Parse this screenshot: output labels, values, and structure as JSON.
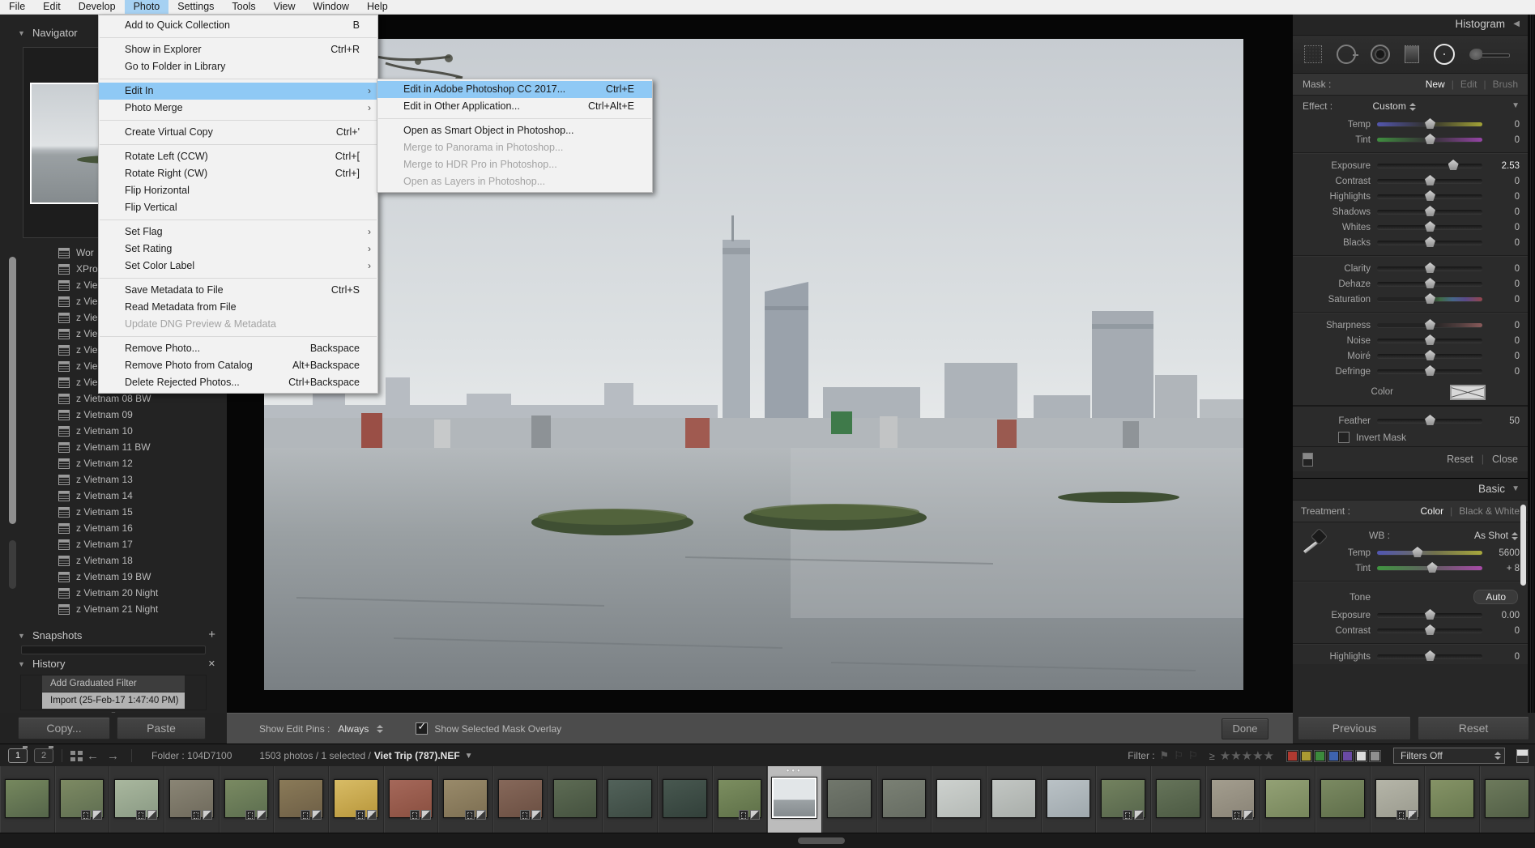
{
  "menu_bar": {
    "items": [
      "File",
      "Edit",
      "Develop",
      "Photo",
      "Settings",
      "Tools",
      "View",
      "Window",
      "Help"
    ],
    "selected": "Photo"
  },
  "photo_menu": {
    "items": [
      {
        "label": "Add to Quick Collection",
        "shortcut": "B",
        "sep": true
      },
      {
        "label": "Show in Explorer",
        "shortcut": "Ctrl+R"
      },
      {
        "label": "Go to Folder in Library",
        "sep": true
      },
      {
        "label": "Edit In",
        "arrow": true,
        "highlighted": true
      },
      {
        "label": "Photo Merge",
        "arrow": true,
        "sep": true
      },
      {
        "label": "Create Virtual Copy",
        "shortcut": "Ctrl+'",
        "sep": true
      },
      {
        "label": "Rotate Left (CCW)",
        "shortcut": "Ctrl+["
      },
      {
        "label": "Rotate Right (CW)",
        "shortcut": "Ctrl+]"
      },
      {
        "label": "Flip Horizontal"
      },
      {
        "label": "Flip Vertical",
        "sep": true
      },
      {
        "label": "Set Flag",
        "arrow": true
      },
      {
        "label": "Set Rating",
        "arrow": true
      },
      {
        "label": "Set Color Label",
        "arrow": true,
        "sep": true
      },
      {
        "label": "Save Metadata to File",
        "shortcut": "Ctrl+S"
      },
      {
        "label": "Read Metadata from File"
      },
      {
        "label": "Update DNG Preview & Metadata",
        "disabled": true,
        "sep": true
      },
      {
        "label": "Remove Photo...",
        "shortcut": "Backspace"
      },
      {
        "label": "Remove Photo from Catalog",
        "shortcut": "Alt+Backspace"
      },
      {
        "label": "Delete Rejected Photos...",
        "shortcut": "Ctrl+Backspace"
      }
    ]
  },
  "edit_in_submenu": {
    "items": [
      {
        "label": "Edit in Adobe Photoshop CC 2017...",
        "shortcut": "Ctrl+E",
        "highlighted": true
      },
      {
        "label": "Edit in Other Application...",
        "shortcut": "Ctrl+Alt+E",
        "sep": true
      },
      {
        "label": "Open as Smart Object in Photoshop..."
      },
      {
        "label": "Merge to Panorama in Photoshop...",
        "disabled": true
      },
      {
        "label": "Merge to HDR Pro in Photoshop...",
        "disabled": true
      },
      {
        "label": "Open as Layers in Photoshop...",
        "disabled": true
      }
    ]
  },
  "left_panel": {
    "navigator_title": "Navigator",
    "folders": [
      "Wor",
      "XPro",
      "z Vie",
      "z Vie",
      "z Vie",
      "z Vie",
      "z Vie",
      "z Vie",
      "z Vie",
      "z Vietnam 08 BW",
      "z Vietnam 09",
      "z Vietnam 10",
      "z Vietnam 11 BW",
      "z Vietnam 12",
      "z Vietnam 13",
      "z Vietnam 14",
      "z Vietnam 15",
      "z Vietnam 16",
      "z Vietnam 17",
      "z Vietnam 18",
      "z Vietnam 19 BW",
      "z Vietnam 20 Night",
      "z Vietnam 21 Night"
    ],
    "snapshots_title": "Snapshots",
    "history_title": "History",
    "history_items": [
      {
        "label": "Add Graduated Filter",
        "selected": false
      },
      {
        "label": "Import (25-Feb-17 1:47:40 PM)",
        "selected": true
      }
    ],
    "copy_label": "Copy...",
    "paste_label": "Paste"
  },
  "right_panel": {
    "histogram_title": "Histogram",
    "mask_label": "Mask :",
    "mask_new": "New",
    "mask_edit": "Edit",
    "mask_brush": "Brush",
    "effect_label": "Effect :",
    "effect_value": "Custom",
    "effect_groups": [
      [
        {
          "label": "Temp",
          "value": "0",
          "knob": 50,
          "track": "temp"
        },
        {
          "label": "Tint",
          "value": "0",
          "knob": 50,
          "track": "tint"
        }
      ],
      [
        {
          "label": "Exposure",
          "value": "2.53",
          "knob": 72,
          "bright": true
        },
        {
          "label": "Contrast",
          "value": "0",
          "knob": 50
        },
        {
          "label": "Highlights",
          "value": "0",
          "knob": 50
        },
        {
          "label": "Shadows",
          "value": "0",
          "knob": 50
        },
        {
          "label": "Whites",
          "value": "0",
          "knob": 50
        },
        {
          "label": "Blacks",
          "value": "0",
          "knob": 50
        }
      ],
      [
        {
          "label": "Clarity",
          "value": "0",
          "knob": 50
        },
        {
          "label": "Dehaze",
          "value": "0",
          "knob": 50
        },
        {
          "label": "Saturation",
          "value": "0",
          "knob": 50,
          "track": "sat"
        }
      ],
      [
        {
          "label": "Sharpness",
          "value": "0",
          "knob": 50,
          "track": "sharp"
        },
        {
          "label": "Noise",
          "value": "0",
          "knob": 50
        },
        {
          "label": "Moiré",
          "value": "0",
          "knob": 50
        },
        {
          "label": "Defringe",
          "value": "0",
          "knob": 50
        }
      ]
    ],
    "color_label": "Color",
    "feather": {
      "label": "Feather",
      "value": "50",
      "knob": 50
    },
    "invert_mask_label": "Invert Mask",
    "reset_label": "Reset",
    "close_label": "Close",
    "basic": {
      "title": "Basic",
      "treatment_label": "Treatment :",
      "treatment_color": "Color",
      "treatment_bw": "Black & White",
      "wb_label": "WB :",
      "wb_value": "As Shot",
      "wb_sliders": [
        {
          "label": "Temp",
          "value": "5600",
          "knob": 38,
          "track": "temp2"
        },
        {
          "label": "Tint",
          "value": "+ 8",
          "knob": 52,
          "track": "tint2"
        }
      ],
      "tone_label": "Tone",
      "auto_label": "Auto",
      "tone_sliders": [
        {
          "label": "Exposure",
          "value": "0.00",
          "knob": 50
        },
        {
          "label": "Contrast",
          "value": "0",
          "knob": 50
        }
      ],
      "extra_sliders": [
        {
          "label": "Highlights",
          "value": "0",
          "knob": 50
        }
      ]
    }
  },
  "toolbar": {
    "show_edit_pins_label": "Show Edit Pins :",
    "show_edit_pins_value": "Always",
    "mask_overlay_label": "Show Selected Mask Overlay",
    "done_label": "Done",
    "previous_label": "Previous",
    "reset_label": "Reset"
  },
  "filmstrip": {
    "monitor1": "1",
    "monitor2": "2",
    "folder_label": "Folder : 104D7100",
    "status": "1503 photos / 1 selected /",
    "filename": "Viet Trip (787).NEF",
    "filter_label": "Filter :",
    "filters_off": "Filters Off",
    "color_chips": [
      "#b03a31",
      "#ab9b32",
      "#3c8a3c",
      "#3e63af",
      "#6a4aa5",
      "#dcdcdc",
      "#8f8f8f"
    ],
    "thumbs": [
      {
        "a": "#55654a",
        "b": "#76885e",
        "badges": false
      },
      {
        "a": "#5f6e51",
        "b": "#7d8a63",
        "badges": true
      },
      {
        "a": "#8a9a84",
        "b": "#a9b79e",
        "badges": true
      },
      {
        "a": "#6f6a5c",
        "b": "#8a8575",
        "badges": true
      },
      {
        "a": "#5c6e4f",
        "b": "#7a8a62",
        "badges": true
      },
      {
        "a": "#6e5f46",
        "b": "#8a7a58",
        "badges": true
      },
      {
        "a": "#b8963a",
        "b": "#d8bc66",
        "badges": true
      },
      {
        "a": "#8a4f40",
        "b": "#a5685a",
        "badges": true
      },
      {
        "a": "#7d6f52",
        "b": "#998a6a",
        "badges": true
      },
      {
        "a": "#6b4f42",
        "b": "#86685a",
        "badges": true
      },
      {
        "a": "#45523f",
        "b": "#5d6b54",
        "badges": false
      },
      {
        "a": "#3c4a42",
        "b": "#52625a",
        "badges": false
      },
      {
        "a": "#32403a",
        "b": "#485850",
        "badges": false
      },
      {
        "a": "#5e7048",
        "b": "#7c8e60",
        "badges": true
      },
      {
        "a": "#c6ccd0",
        "b": "#e2e6e8",
        "badges": false,
        "selected": true
      },
      {
        "a": "#5d635a",
        "b": "#71776c",
        "badges": false
      },
      {
        "a": "#666c62",
        "b": "#7a8074",
        "badges": false
      },
      {
        "a": "#b5bab6",
        "b": "#cdd1ce",
        "badges": false
      },
      {
        "a": "#a9aeaa",
        "b": "#c2c6c3",
        "badges": false
      },
      {
        "a": "#9fa8ad",
        "b": "#bac2c6",
        "badges": false
      },
      {
        "a": "#57664c",
        "b": "#73825f",
        "badges": true
      },
      {
        "a": "#4c5a43",
        "b": "#66745a",
        "badges": false
      },
      {
        "a": "#8a8477",
        "b": "#a39d8e",
        "badges": true
      },
      {
        "a": "#77865c",
        "b": "#93a175",
        "badges": false
      },
      {
        "a": "#5f6e4a",
        "b": "#7b8a62",
        "badges": false
      },
      {
        "a": "#9b9b8f",
        "b": "#b5b5a8",
        "badges": true
      },
      {
        "a": "#68784f",
        "b": "#859366",
        "badges": false
      },
      {
        "a": "#525f46",
        "b": "#6d7a5c",
        "badges": false
      }
    ]
  }
}
